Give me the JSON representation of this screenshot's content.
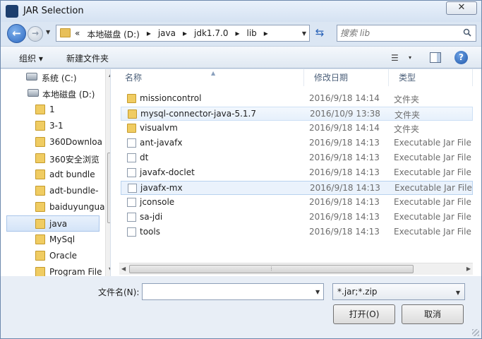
{
  "window": {
    "title": "JAR Selection",
    "close_label": "✕"
  },
  "nav": {
    "back": "←",
    "forward": "→",
    "history": "▼",
    "breadcrumbs": [
      "«",
      "本地磁盘 (D:)",
      "▸",
      "java",
      "▸",
      "jdk1.7.0",
      "▸",
      "lib",
      "▸"
    ],
    "address_dropdown": "▼",
    "refresh": "⇆",
    "search_placeholder": "搜索 lib"
  },
  "toolbar": {
    "organize": "组织 ▾",
    "new_folder": "新建文件夹",
    "view_menu": "▾"
  },
  "sidebar": {
    "items": [
      {
        "label": "系统 (C:)",
        "kind": "drive"
      },
      {
        "label": "本地磁盘 (D:)",
        "kind": "drive"
      },
      {
        "label": "1",
        "kind": "folder"
      },
      {
        "label": "3-1",
        "kind": "folder"
      },
      {
        "label": "360Downloa",
        "kind": "folder"
      },
      {
        "label": "360安全浏览",
        "kind": "folder"
      },
      {
        "label": "adt bundle",
        "kind": "folder"
      },
      {
        "label": "adt-bundle-",
        "kind": "folder"
      },
      {
        "label": "baiduyungua",
        "kind": "folder"
      },
      {
        "label": "java",
        "kind": "folder",
        "selected": true
      },
      {
        "label": "MySql",
        "kind": "folder"
      },
      {
        "label": "Oracle",
        "kind": "folder"
      },
      {
        "label": "Program File",
        "kind": "folder"
      }
    ]
  },
  "columns": {
    "name": "名称",
    "date": "修改日期",
    "type": "类型"
  },
  "files": [
    {
      "name": "missioncontrol",
      "date": "2016/9/18 14:14",
      "type": "文件夹",
      "kind": "folder"
    },
    {
      "name": "mysql-connector-java-5.1.7",
      "date": "2016/10/9 13:38",
      "type": "文件夹",
      "kind": "folder",
      "state": "hover"
    },
    {
      "name": "visualvm",
      "date": "2016/9/18 14:14",
      "type": "文件夹",
      "kind": "folder"
    },
    {
      "name": "ant-javafx",
      "date": "2016/9/18 14:13",
      "type": "Executable Jar File",
      "kind": "jar"
    },
    {
      "name": "dt",
      "date": "2016/9/18 14:13",
      "type": "Executable Jar File",
      "kind": "jar"
    },
    {
      "name": "javafx-doclet",
      "date": "2016/9/18 14:13",
      "type": "Executable Jar File",
      "kind": "jar"
    },
    {
      "name": "javafx-mx",
      "date": "2016/9/18 14:13",
      "type": "Executable Jar File",
      "kind": "jar",
      "state": "selected"
    },
    {
      "name": "jconsole",
      "date": "2016/9/18 14:13",
      "type": "Executable Jar File",
      "kind": "jar"
    },
    {
      "name": "sa-jdi",
      "date": "2016/9/18 14:13",
      "type": "Executable Jar File",
      "kind": "jar"
    },
    {
      "name": "tools",
      "date": "2016/9/18 14:13",
      "type": "Executable Jar File",
      "kind": "jar"
    }
  ],
  "footer": {
    "filename_label": "文件名(N):",
    "filename_value": "",
    "filter": "*.jar;*.zip",
    "open_button": "打开(O)",
    "cancel_button": "取消"
  }
}
